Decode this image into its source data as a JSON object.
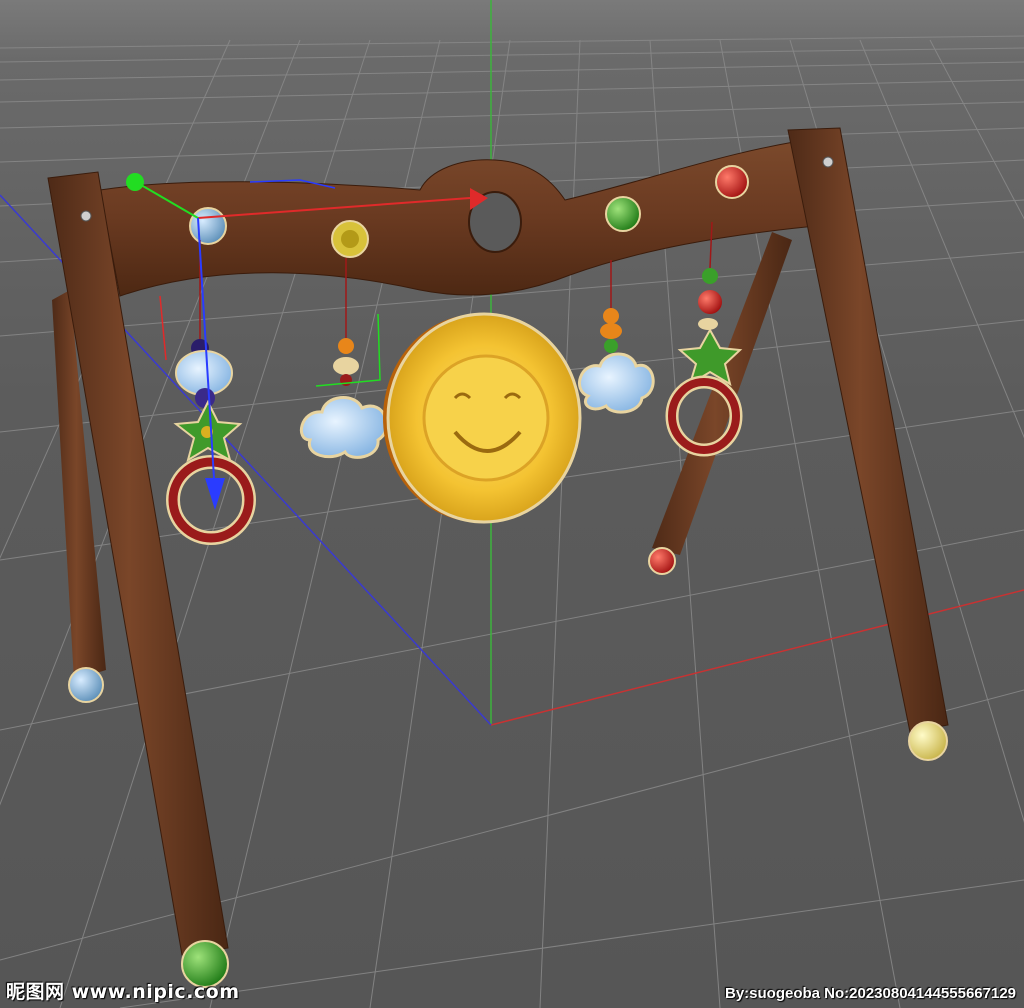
{
  "viewport": {
    "background": "#5e5e5e",
    "grid_color": "#8a8a8a",
    "axis_colors": {
      "x": "#c83232",
      "y": "#3cb43c",
      "z": "#3a3ad0"
    }
  },
  "model": {
    "wood_color": "#6b3b22",
    "foot_colors": [
      "#8ab8d8",
      "#3a9a2a",
      "#d62020",
      "#e8d870"
    ],
    "sun_color": "#f2c12e",
    "ring_color": "#9a1b1b"
  },
  "gizmo": {
    "x_color": "#e02a2a",
    "y_color": "#22dd22",
    "z_color": "#2a3cff"
  },
  "watermark": {
    "site": "昵图网 www.nipic.com",
    "credit": "By:suogeoba No:20230804144555667129"
  }
}
